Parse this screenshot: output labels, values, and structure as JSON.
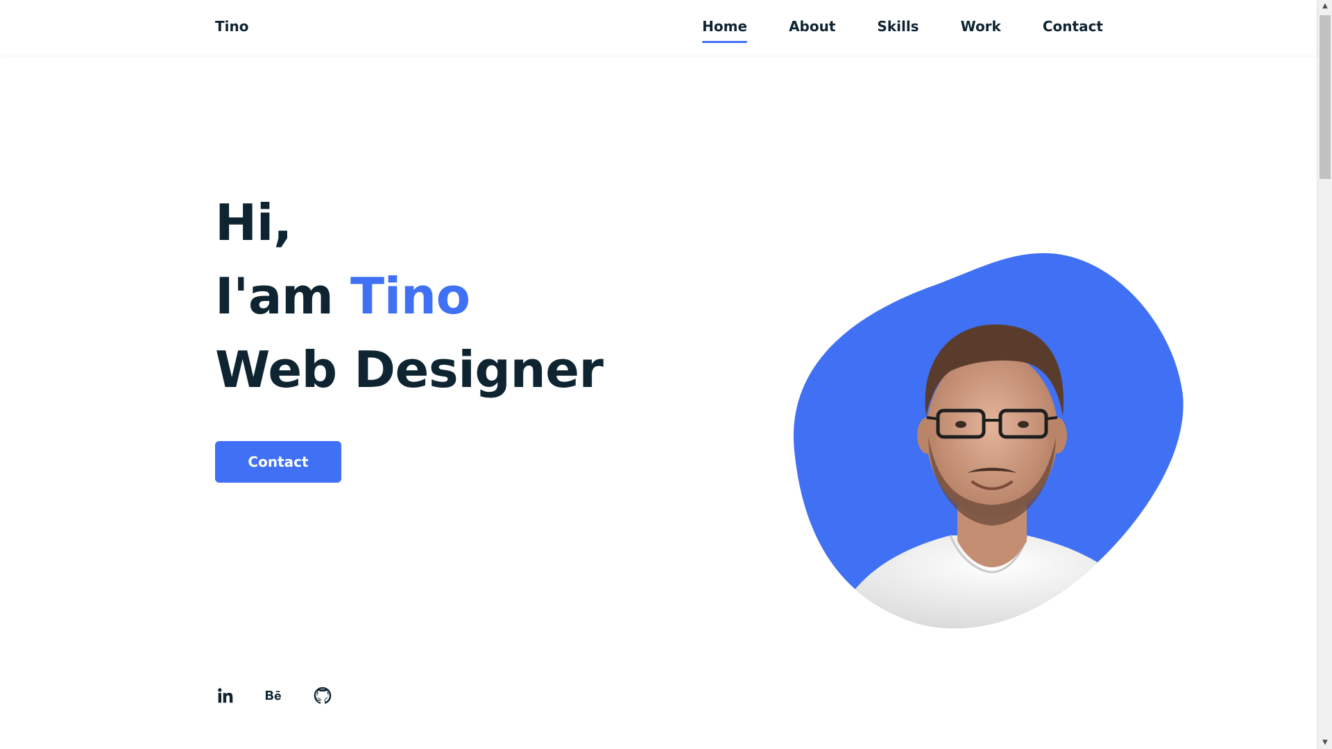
{
  "header": {
    "logo": "Tino",
    "nav": [
      {
        "label": "Home",
        "active": true
      },
      {
        "label": "About",
        "active": false
      },
      {
        "label": "Skills",
        "active": false
      },
      {
        "label": "Work",
        "active": false
      },
      {
        "label": "Contact",
        "active": false
      }
    ]
  },
  "hero": {
    "line1": "Hi,",
    "line2_prefix": "I'am ",
    "line2_name": "Tino",
    "line3": "Web Designer",
    "button_label": "Contact"
  },
  "socials": [
    {
      "icon": "linkedin-icon",
      "glyph": "in"
    },
    {
      "icon": "behance-icon",
      "glyph": "Bē"
    },
    {
      "icon": "github-icon",
      "glyph": ""
    }
  ],
  "colors": {
    "accent": "#4070f4",
    "text_dark": "#0e2431",
    "background": "#ffffff"
  }
}
